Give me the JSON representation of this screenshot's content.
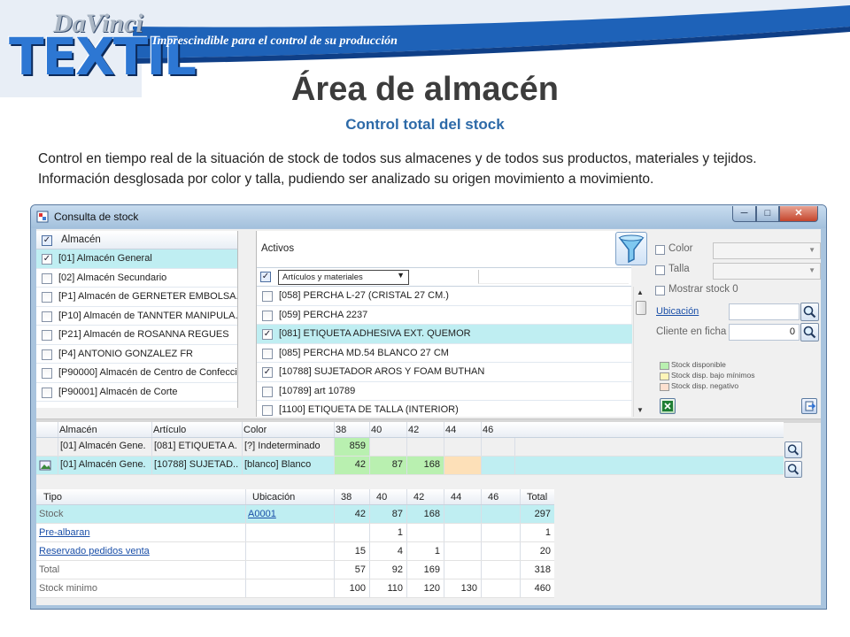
{
  "brand": {
    "logo_top": "DaVinci",
    "logo_main": "TEXTIL",
    "tagline": "Imprescindible para el control de su producción",
    "colors": {
      "banner": "#1e62b8",
      "logo": "#2d77d3",
      "subtitle": "#2d6aa8"
    }
  },
  "slide": {
    "title": "Área de almacén",
    "subtitle": "Control total del stock",
    "description": "Control en tiempo real de la situación de stock de todos sus almacenes y de todos sus productos, materiales y tejidos. Información desglosada por color y talla, pudiendo ser analizado su origen movimiento a movimiento."
  },
  "window": {
    "title": "Consulta de stock",
    "icons": {
      "app": "app-window-icon",
      "minimize": "minimize-icon",
      "maximize": "maximize-icon",
      "close": "close-icon"
    }
  },
  "warehouses": {
    "header": "Almacén",
    "items": [
      {
        "label": "[01] Almacén General",
        "checked": true,
        "selected": true
      },
      {
        "label": "[02] Almacén Secundario",
        "checked": false
      },
      {
        "label": "[P1] Almacén de GERNETER EMBOLSA...",
        "checked": false
      },
      {
        "label": "[P10] Almacén de TANNTER MANIPULA...",
        "checked": false
      },
      {
        "label": "[P21] Almacén de ROSANNA REGUES",
        "checked": false
      },
      {
        "label": "[P4] ANTONIO GONZALEZ FR",
        "checked": false
      },
      {
        "label": "[P90000] Almacén de Centro de Confecci...",
        "checked": false
      },
      {
        "label": "[P90001] Almacén de Corte",
        "checked": false
      }
    ]
  },
  "products": {
    "activos_label": "Activos",
    "filter_combo": "Artículos y materiales",
    "items": [
      {
        "label": "[058] PERCHA L-27 (CRISTAL 27 CM.)",
        "checked": false
      },
      {
        "label": "[059] PERCHA 2237",
        "checked": false
      },
      {
        "label": "[081] ETIQUETA ADHESIVA EXT. QUEMOR",
        "checked": true,
        "selected": true
      },
      {
        "label": "[085] PERCHA MD.54 BLANCO 27 CM",
        "checked": false
      },
      {
        "label": "[10788] SUJETADOR AROS Y FOAM BUTHAN",
        "checked": true
      },
      {
        "label": "[10789] art 10789",
        "checked": false
      },
      {
        "label": "[1100] ETIQUETA DE TALLA (INTERIOR)",
        "checked": false
      }
    ]
  },
  "filters": {
    "color_label": "Color",
    "talla_label": "Talla",
    "mostrar_stock_label": "Mostrar stock 0",
    "ubicacion_label": "Ubicación",
    "ubicacion_value": "",
    "cliente_label": "Cliente en ficha",
    "cliente_value": "0",
    "legend": [
      {
        "label": "Stock disponible",
        "color": "#b9f0b0"
      },
      {
        "label": "Stock disp. bajo mínimos",
        "color": "#fff5b8"
      },
      {
        "label": "Stock disp. negativo",
        "color": "#fde0d0"
      }
    ]
  },
  "stock_grid": {
    "columns": [
      "Almacén",
      "Artículo",
      "Color",
      "38",
      "40",
      "42",
      "44",
      "46"
    ],
    "rows": [
      {
        "almacen": "[01] Almacén Gene...",
        "articulo": "[081] ETIQUETA A...",
        "color": "[?] Indeterminado",
        "values": [
          "859",
          "",
          "",
          "",
          ""
        ]
      },
      {
        "almacen": "[01] Almacén Gene...",
        "articulo": "[10788] SUJETAD...",
        "color": "[blanco] Blanco",
        "values": [
          "42",
          "87",
          "168",
          "",
          ""
        ]
      }
    ]
  },
  "detail_grid": {
    "columns": [
      "Tipo",
      "Ubicación",
      "38",
      "40",
      "42",
      "44",
      "46",
      "Total"
    ],
    "rows": [
      {
        "tipo": "Stock",
        "ubicacion": "A0001",
        "values": [
          "42",
          "87",
          "168",
          "",
          ""
        ],
        "total": "297"
      },
      {
        "tipo": "Pre-albaran",
        "ubicacion": "",
        "values": [
          "",
          "1",
          "",
          "",
          ""
        ],
        "total": "1"
      },
      {
        "tipo": "Reservado pedidos venta",
        "ubicacion": "",
        "values": [
          "15",
          "4",
          "1",
          "",
          ""
        ],
        "total": "20"
      },
      {
        "tipo": "Total",
        "ubicacion": "",
        "values": [
          "57",
          "92",
          "169",
          "",
          ""
        ],
        "total": "318"
      },
      {
        "tipo": "Stock minimo",
        "ubicacion": "",
        "values": [
          "100",
          "110",
          "120",
          "130",
          ""
        ],
        "total": "460"
      }
    ]
  }
}
